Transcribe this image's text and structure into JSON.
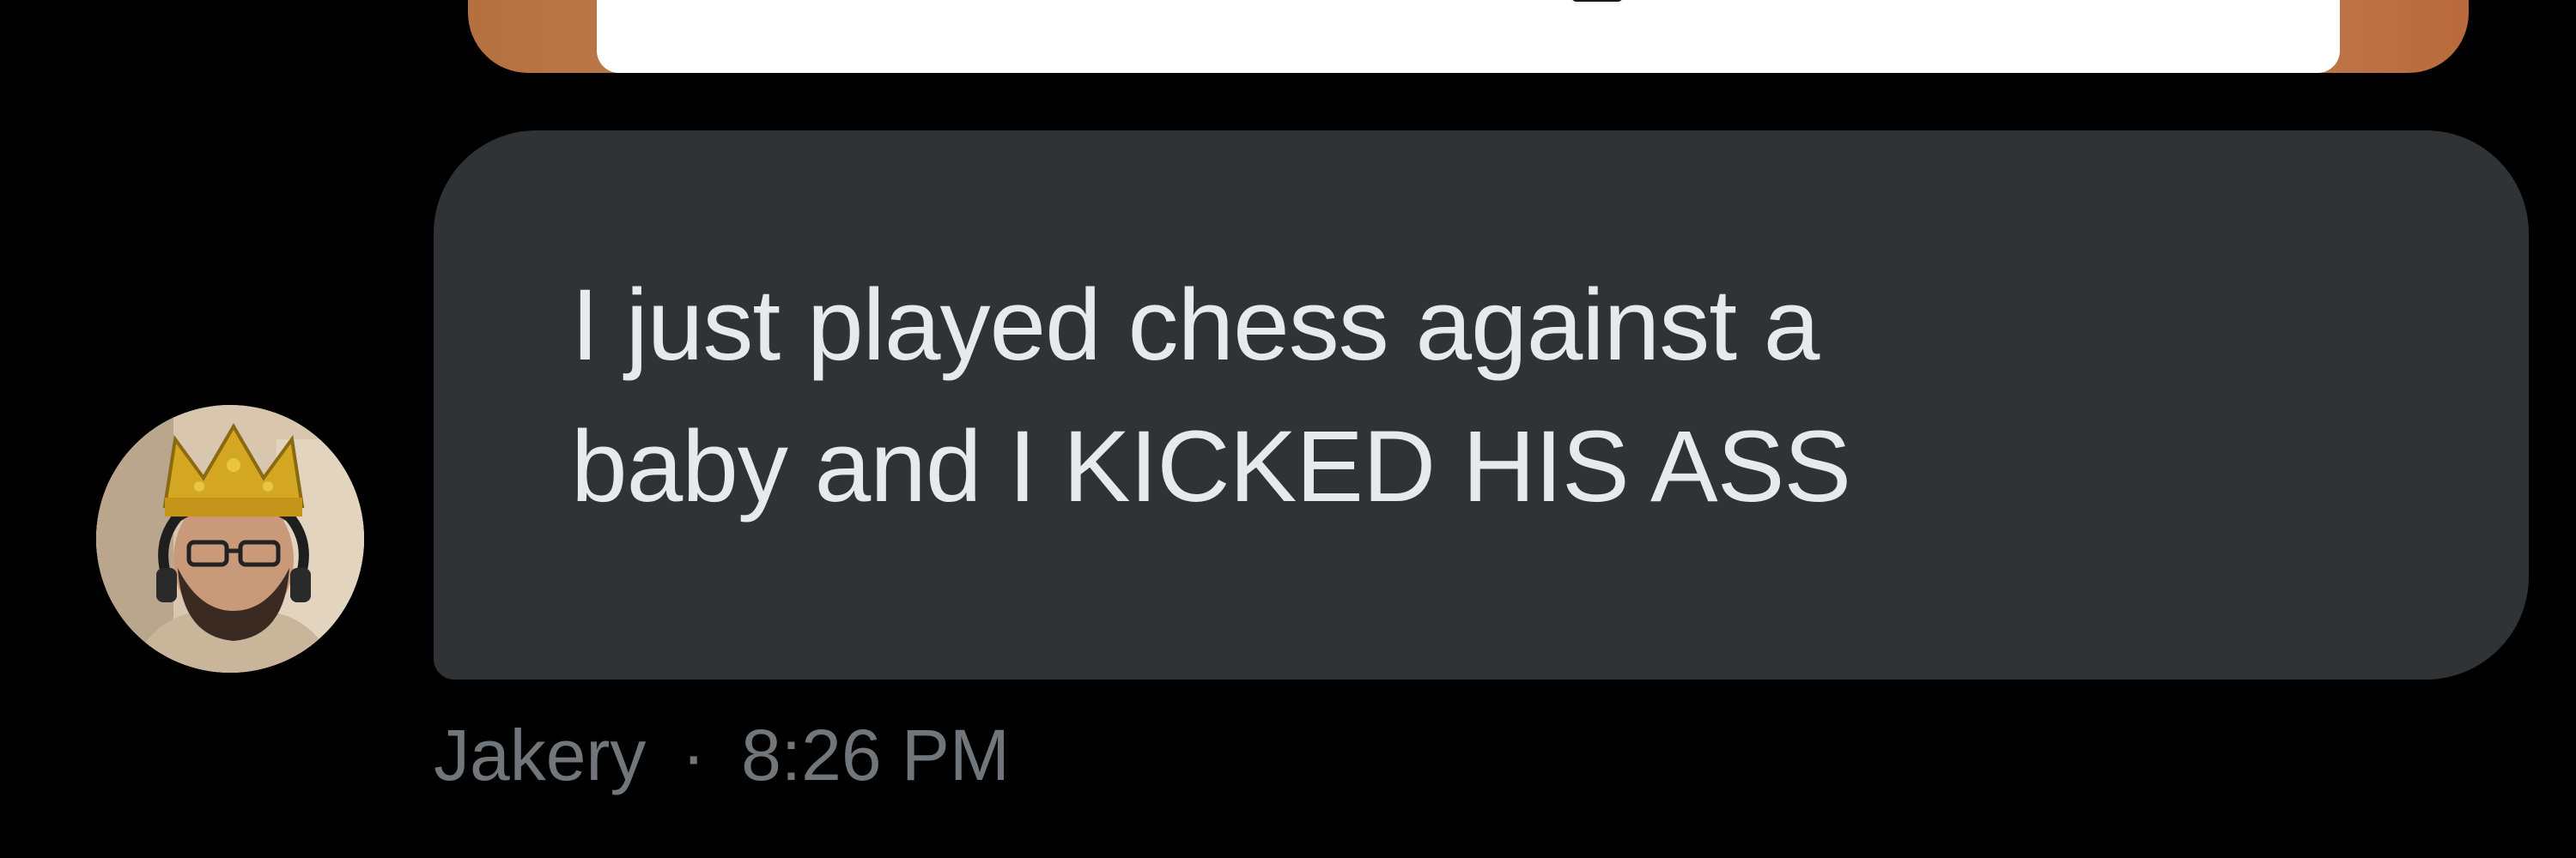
{
  "conversation": {
    "previous_message": {
      "type": "image-attachment",
      "icon": "image-icon"
    },
    "message": {
      "text": "I just played chess against a\nbaby and I KICKED HIS ASS",
      "sender": "Jakery",
      "separator": "·",
      "time": "8:26 PM",
      "avatar": "avatar-photo"
    }
  },
  "colors": {
    "background": "#000000",
    "bubble": "#2f3336",
    "message_text": "#e7e9ea",
    "meta_text": "#71767b"
  }
}
